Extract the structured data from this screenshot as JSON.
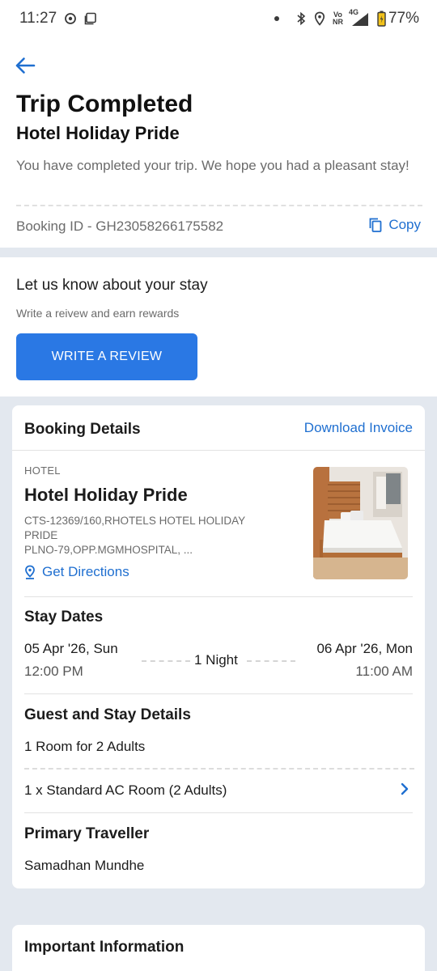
{
  "status_bar": {
    "time": "11:27",
    "network_top": "Vo",
    "network_bottom": "NR",
    "signal_label": "4G",
    "battery": "77%"
  },
  "header": {
    "title": "Trip Completed",
    "hotel_name": "Hotel Holiday Pride",
    "description": "You have completed your trip. We hope you had a pleasant stay!",
    "booking_id": "Booking ID - GH23058266175582",
    "copy_label": "Copy"
  },
  "review": {
    "title": "Let us know about your stay",
    "subtitle": "Write a reivew and earn rewards",
    "button_label": "WRITE A REVIEW"
  },
  "booking_details": {
    "title": "Booking Details",
    "invoice_label": "Download Invoice",
    "hotel_label": "HOTEL",
    "hotel_name": "Hotel Holiday Pride",
    "address_line1": "CTS-12369/160,RHOTELS HOTEL HOLIDAY",
    "address_line2": "PRIDE",
    "address_line3": "PLNO-79,OPP.MGMHOSPITAL, ...",
    "directions_label": "Get Directions",
    "stay_dates": {
      "title": "Stay Dates",
      "checkin_date": "05 Apr '26, Sun",
      "checkin_time": "12:00 PM",
      "nights": "1 Night",
      "checkout_date": "06 Apr '26, Mon",
      "checkout_time": "11:00 AM"
    },
    "guest": {
      "title": "Guest and Stay Details",
      "rooms": "1 Room for 2 Adults",
      "room_type": "1 x Standard AC Room (2 Adults)"
    },
    "traveller": {
      "title": "Primary Traveller",
      "name": "Samadhan Mundhe"
    }
  },
  "important": {
    "title": "Important Information"
  },
  "colors": {
    "accent": "#2a78e4",
    "link": "#1f6fd0",
    "background": "#e3e8ef"
  }
}
